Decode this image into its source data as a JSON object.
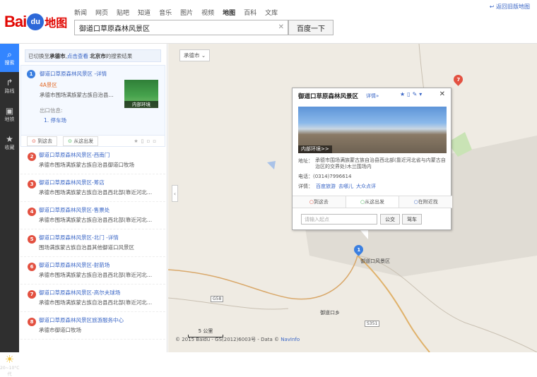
{
  "header": {
    "logo_text": "Bai",
    "logo_paw": "du",
    "logo_map": "地图",
    "nav": [
      "新闻",
      "网页",
      "贴吧",
      "知道",
      "音乐",
      "图片",
      "视频",
      "地图",
      "百科",
      "文库"
    ],
    "search_value": "御道口草原森林风景区",
    "search_button": "百度一下",
    "old_version_link": "返回旧版地图"
  },
  "left_bar": {
    "items": [
      {
        "icon": "search-icon",
        "label": "搜索",
        "active": true
      },
      {
        "icon": "route-icon",
        "label": "路线"
      },
      {
        "icon": "subway-icon",
        "label": "地铁"
      },
      {
        "icon": "star-icon",
        "label": "收藏"
      }
    ],
    "weather": "20~10°C",
    "weather_sub": "代"
  },
  "panel": {
    "switch_prefix": "已切换至",
    "switch_city": "承德市",
    "switch_link": "点击查看",
    "switch_city2": "北京市",
    "switch_suffix": "的搜索结果",
    "first": {
      "index": "1",
      "title": "御道口草原森林风景区 -详情",
      "tag": "4A景区",
      "desc": "承德市围场满族蒙古族自治县...",
      "exit_label": "出口信息:",
      "exit_value": "1. 停车场",
      "thumb_caption": "内部环境",
      "action_to": "到这去",
      "action_from": "从这出发"
    },
    "results": [
      {
        "index": "2",
        "title": "御道口草原森林风景区-西南门",
        "desc": "承德市围场满族蒙古族自治县御道口牧场"
      },
      {
        "index": "3",
        "title": "御道口草原森林风景区-筹店",
        "desc": "承德市围场满族蒙古族自治县西北部(靠近河北..."
      },
      {
        "index": "4",
        "title": "御道口草原森林风景区-售票处",
        "desc": "承德市围场满族蒙古族自治县西北部(靠近河北..."
      },
      {
        "index": "5",
        "title": "御道口草原森林风景区-北门 -详情",
        "desc": "围场满族蒙古族自治县其他御道口风景区"
      },
      {
        "index": "6",
        "title": "御道口草原森林风景区-射箭场",
        "desc": "承德市围场满族蒙古族自治县西北部(靠近河北..."
      },
      {
        "index": "7",
        "title": "御道口草原森林风景区-高尔夫球场",
        "desc": "承德市围场满族蒙古族自治县西北部(靠近河北..."
      },
      {
        "index": "8",
        "title": "御道口草原森林风景区旅游服务中心",
        "desc": "承德市御道口牧场"
      }
    ]
  },
  "map": {
    "city_selector": "承德市",
    "popup": {
      "title": "御道口草原森林风景区",
      "detail_link": "详情»",
      "photo_caption": "内部环境>>",
      "addr_label": "地址：",
      "addr_value": "承德市围场满族蒙古族自治县西北部(靠近河北省与内蒙古自治区的交界处)木兰围场内",
      "tel": "电话：(0314)7996614",
      "detail_label": "详情：",
      "detail_links": [
        "百度旅游",
        "去哪儿",
        "大众点评"
      ],
      "tab_to": "到这去",
      "tab_from": "从这出发",
      "tab_nearby": "在附近找",
      "start_placeholder": "请输入起点",
      "bus_button": "公交",
      "drive_button": "驾车"
    },
    "marker_label": "御道口风景区",
    "town_label": "御道口乡",
    "roads": [
      "G58",
      "S351"
    ],
    "scale": "5 公里",
    "footer_text": "© 2015 Baidu - GS(2012)6003号 - Data ©",
    "footer_link": "NavInfo"
  }
}
